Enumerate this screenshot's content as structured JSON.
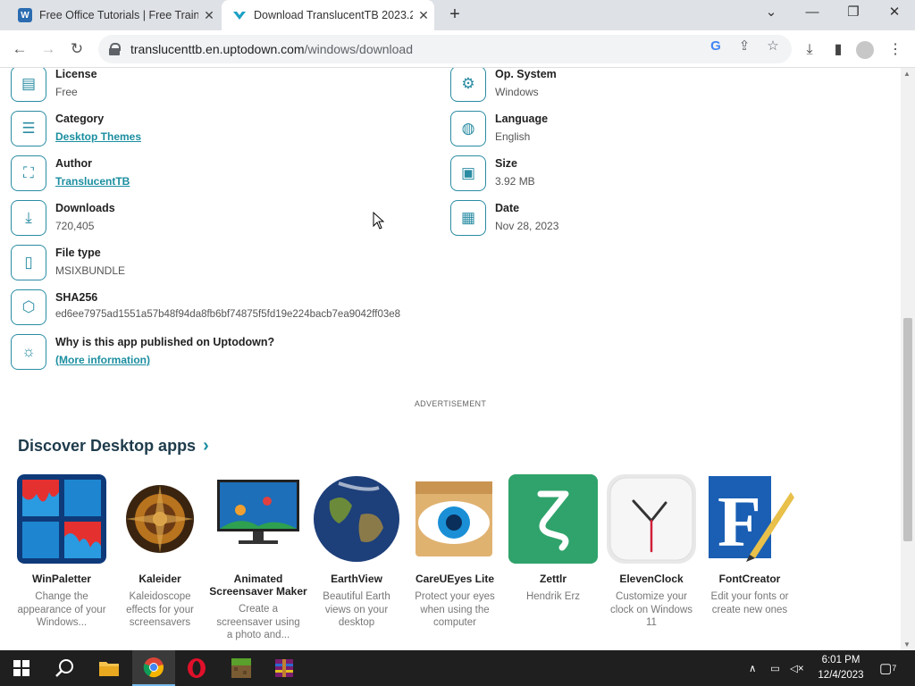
{
  "browser": {
    "tabs": [
      {
        "title": "Free Office Tutorials | Free Trainin",
        "close": "✕"
      },
      {
        "title": "Download TranslucentTB 2023.2",
        "close": "✕"
      }
    ],
    "new_tab": "+",
    "window_controls": {
      "dropdown": "⌄",
      "minimize": "—",
      "restore": "❐",
      "close": "✕"
    },
    "url_host": "translucenttb.en.uptodown.com",
    "url_path": "/windows/download",
    "accent": "#1b8ea0"
  },
  "specs": {
    "left": [
      {
        "label": "License",
        "value": "Free",
        "link": false,
        "icon": "license-icon"
      },
      {
        "label": "Category",
        "value": "Desktop Themes",
        "link": true,
        "icon": "list-icon"
      },
      {
        "label": "Author",
        "value": "TranslucentTB",
        "link": true,
        "icon": "author-icon"
      },
      {
        "label": "Downloads",
        "value": "720,405",
        "link": false,
        "icon": "download-icon"
      },
      {
        "label": "File type",
        "value": "MSIXBUNDLE",
        "link": false,
        "icon": "file-icon"
      },
      {
        "label": "SHA256",
        "value": "ed6ee7975ad1551a57b48f94da8fb6bf74875f5fd19e224bacb7ea9042ff03e8",
        "link": false,
        "icon": "shield-icon"
      },
      {
        "label": "Why is this app published on Uptodown?",
        "value": "(More information)",
        "link": true,
        "icon": "lightbulb-icon"
      }
    ],
    "right": [
      {
        "label": "Op. System",
        "value": "Windows",
        "link": false,
        "icon": "os-icon"
      },
      {
        "label": "Language",
        "value": "English",
        "link": false,
        "icon": "globe-icon"
      },
      {
        "label": "Size",
        "value": "3.92 MB",
        "link": false,
        "icon": "disk-icon"
      },
      {
        "label": "Date",
        "value": "Nov 28, 2023",
        "link": false,
        "icon": "calendar-icon"
      }
    ]
  },
  "advertisement": "ADVERTISEMENT",
  "discover": {
    "title": "Discover Desktop apps",
    "apps": [
      {
        "name": "WinPaletter",
        "desc": "Change the appearance of your Windows..."
      },
      {
        "name": "Kaleider",
        "desc": "Kaleidoscope effects for your screensavers"
      },
      {
        "name": "Animated Screensaver Maker",
        "desc": "Create a screensaver using a photo and..."
      },
      {
        "name": "EarthView",
        "desc": "Beautiful Earth views on your desktop"
      },
      {
        "name": "CareUEyes Lite",
        "desc": "Protect your eyes when using the computer"
      },
      {
        "name": "Zettlr",
        "desc": "Hendrik Erz"
      },
      {
        "name": "ElevenClock",
        "desc": "Customize your clock on Windows 11"
      },
      {
        "name": "FontCreator",
        "desc": "Edit your fonts or create new ones"
      }
    ]
  },
  "taskbar": {
    "time": "6:01 PM",
    "date": "12/4/2023",
    "notifications": "7"
  }
}
